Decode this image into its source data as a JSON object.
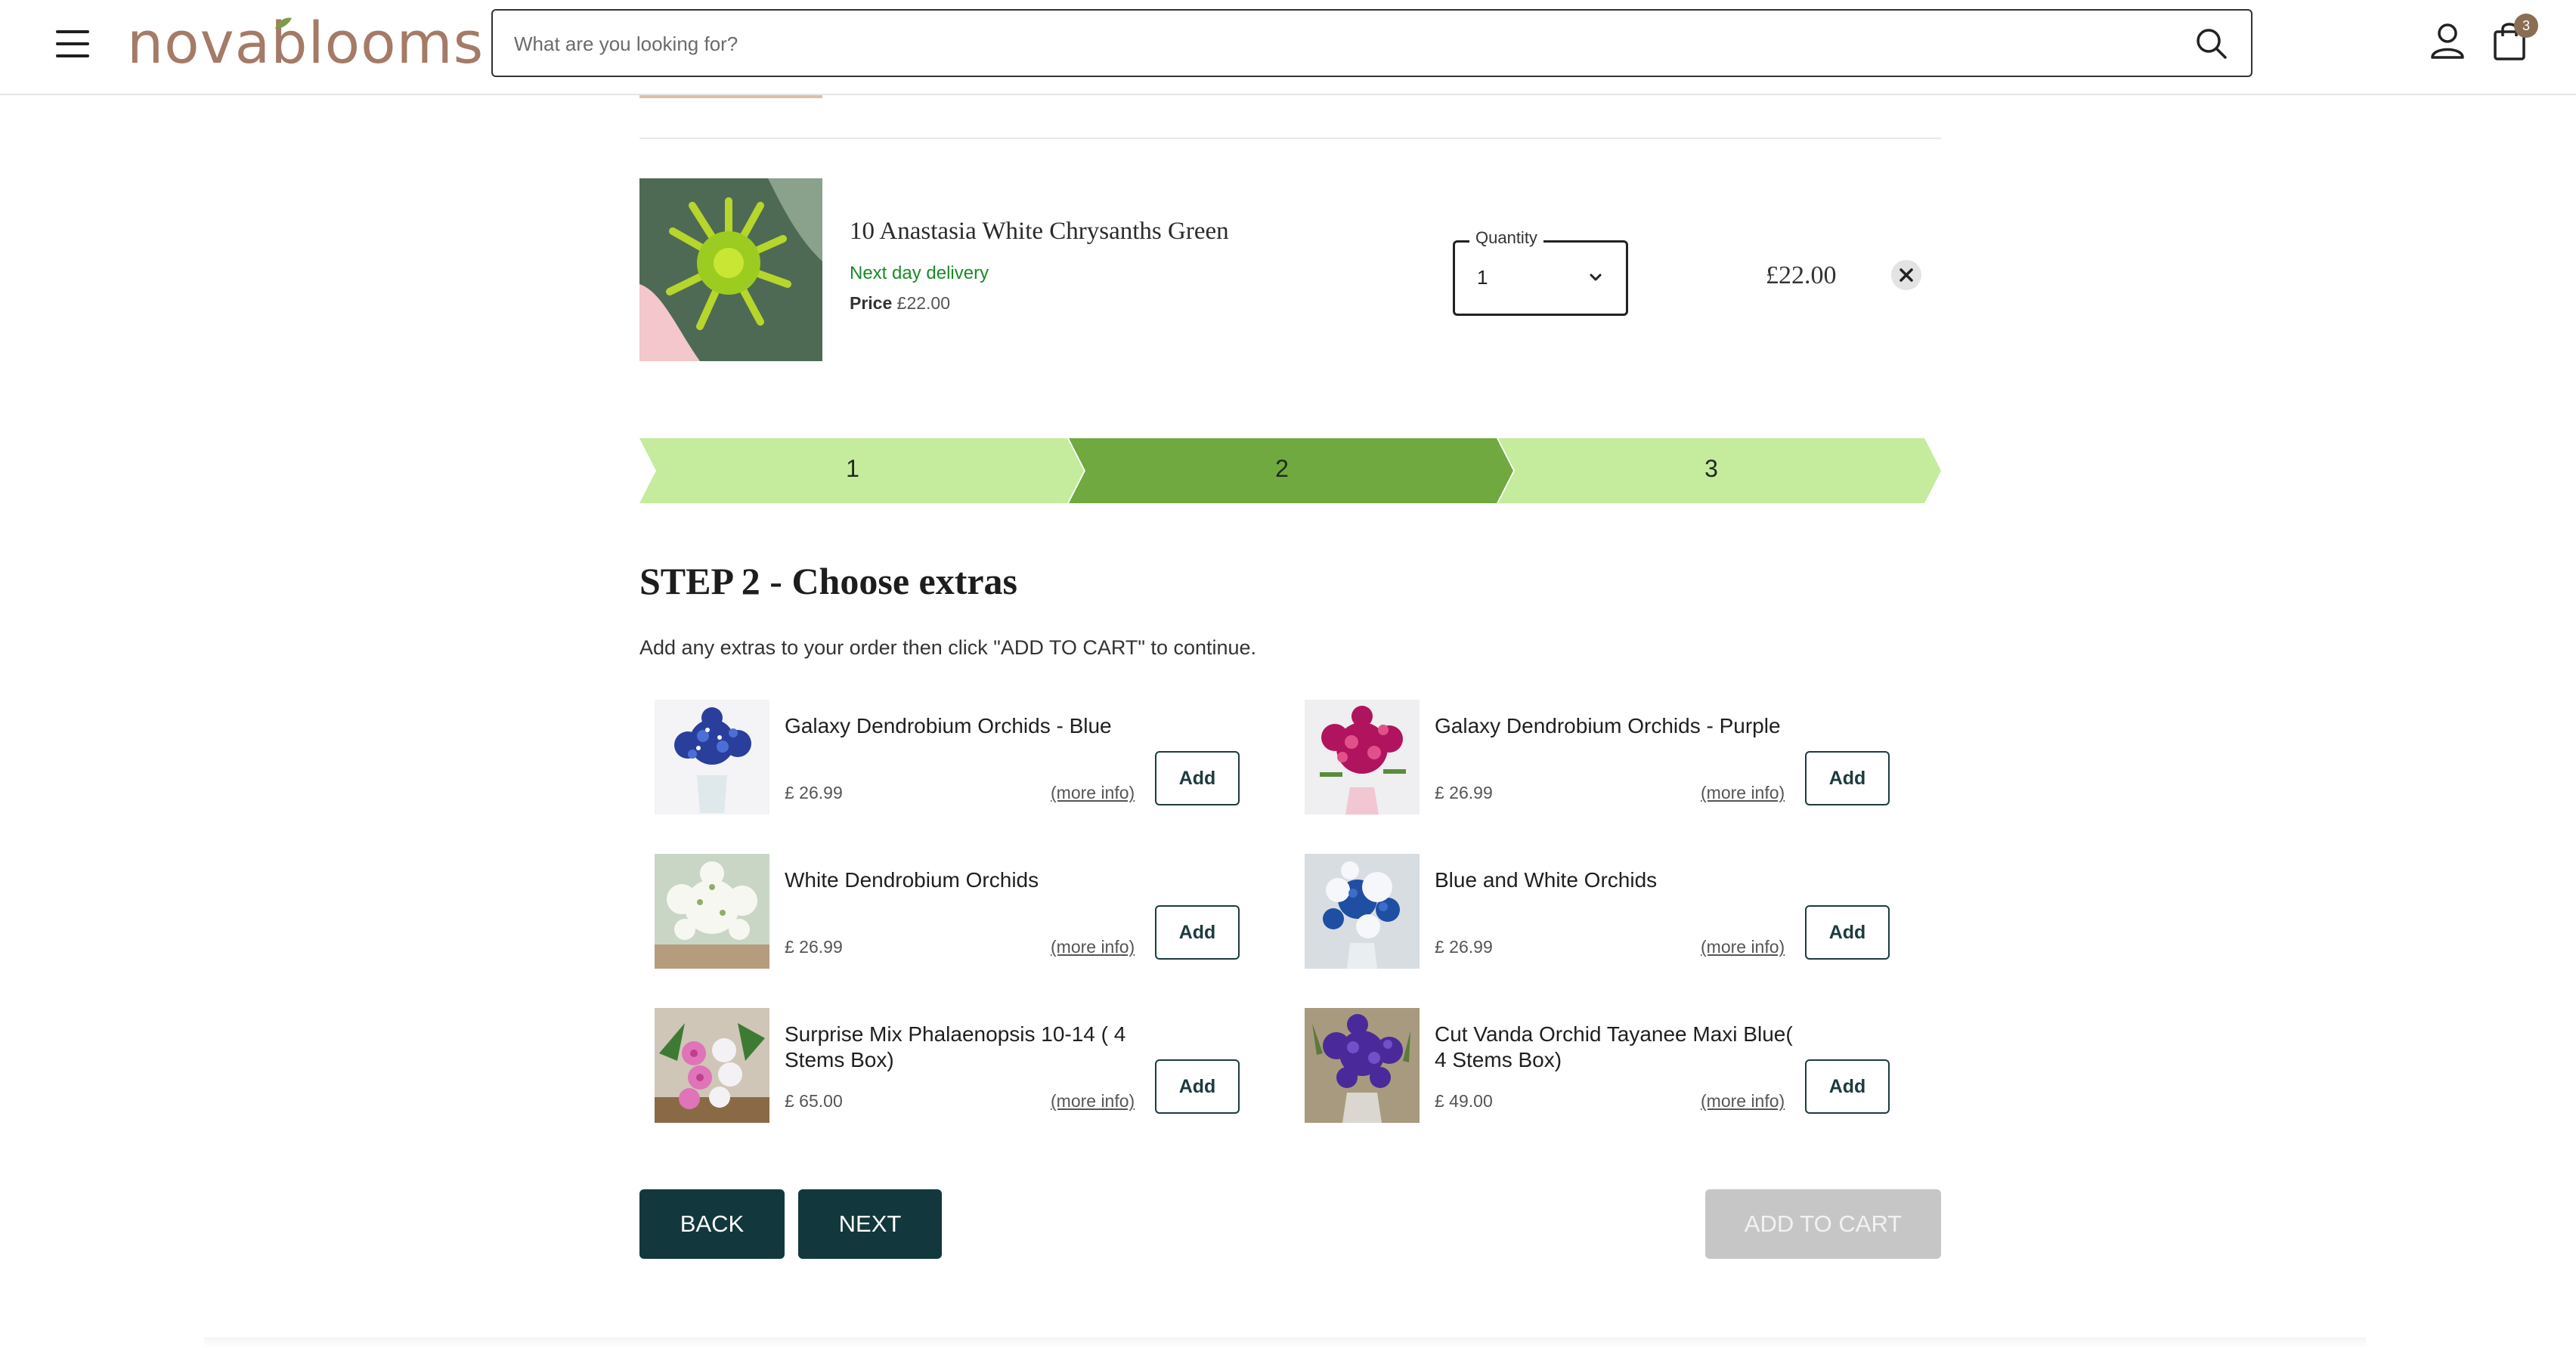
{
  "header": {
    "logo_text": "novablooms",
    "search_placeholder": "What are you looking for?",
    "cart_count": "3"
  },
  "cart_item": {
    "title": "10 Anastasia White Chrysanths Green",
    "delivery": "Next day delivery",
    "price_label": "Price",
    "price_value": "£22.00",
    "quantity_label": "Quantity",
    "quantity_value": "1",
    "total": "£22.00"
  },
  "steps": [
    {
      "label": "1",
      "active": false
    },
    {
      "label": "2",
      "active": true
    },
    {
      "label": "3",
      "active": false
    }
  ],
  "step": {
    "heading": "STEP 2 - Choose extras",
    "description": "Add any extras to your order then click \"ADD TO CART\" to continue."
  },
  "extras": [
    {
      "name": "Galaxy Dendrobium Orchids - Blue",
      "price": "£ 26.99",
      "more": "(more info)",
      "add": "Add"
    },
    {
      "name": "Galaxy Dendrobium Orchids - Purple",
      "price": "£ 26.99",
      "more": "(more info)",
      "add": "Add"
    },
    {
      "name": "White Dendrobium Orchids",
      "price": "£ 26.99",
      "more": "(more info)",
      "add": "Add"
    },
    {
      "name": "Blue and White Orchids",
      "price": "£ 26.99",
      "more": "(more info)",
      "add": "Add"
    },
    {
      "name": "Surprise Mix Phalaenopsis 10-14 ( 4 Stems Box)",
      "price": "£ 65.00",
      "more": "(more info)",
      "add": "Add"
    },
    {
      "name": "Cut Vanda Orchid Tayanee Maxi Blue( 4 Stems Box)",
      "price": "£ 49.00",
      "more": "(more info)",
      "add": "Add"
    }
  ],
  "actions": {
    "back": "BACK",
    "next": "NEXT",
    "add_to_cart": "ADD TO CART"
  },
  "colors": {
    "brand": "#a57a66",
    "dark_teal": "#12383d",
    "step_active": "#6fa93f",
    "step_inactive": "#c5eb9c",
    "delivery_green": "#1a8a2a"
  }
}
